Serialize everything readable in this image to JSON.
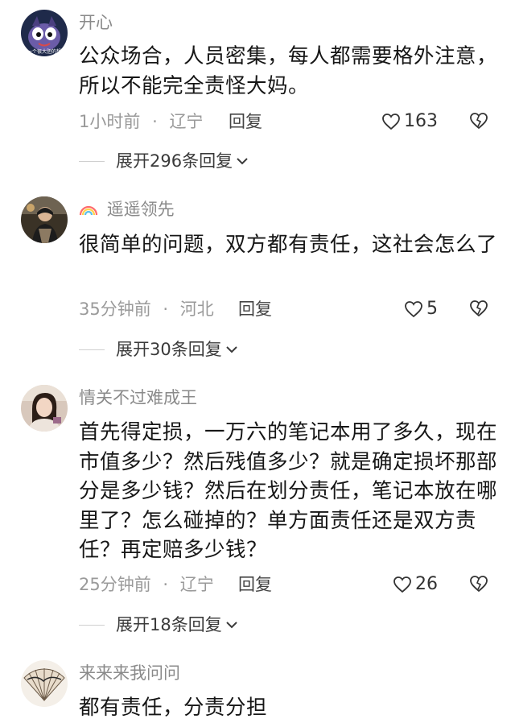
{
  "comments": [
    {
      "username": "开心",
      "avatar_icon": "cartoon-avatar-icon",
      "avatar_caption": "我一个很大胆的想",
      "content": "公众场合，人员密集，每人都需要格外注意，所以不能完全责怪大妈。",
      "time": "1小时前",
      "location": "辽宁",
      "reply_label": "回复",
      "likes": "163",
      "expand_label": "展开296条回复"
    },
    {
      "username": "遥遥领先",
      "username_prefix_icon": "rainbow-icon",
      "avatar_icon": "person-photo-avatar-icon",
      "content": "很简单的问题，双方都有责任，这社会怎么了",
      "time": "35分钟前",
      "location": "河北",
      "reply_label": "回复",
      "likes": "5",
      "expand_label": "展开30条回复"
    },
    {
      "username": "情关不过难成王",
      "avatar_icon": "girl-photo-avatar-icon",
      "content": "首先得定损，一万六的笔记本用了多久，现在市值多少？然后残值多少？就是确定损坏那部分是多少钱？然后在划分责任，笔记本放在哪里了？怎么碰掉的？单方面责任还是双方责任？再定赔多少钱？",
      "time": "25分钟前",
      "location": "辽宁",
      "reply_label": "回复",
      "likes": "26",
      "expand_label": "展开18条回复"
    },
    {
      "username": "来来来我问问",
      "avatar_icon": "fan-avatar-icon",
      "content": "都有责任，分责分担"
    }
  ],
  "meta_separator": "·",
  "colors": {
    "username": "#8a8a8a",
    "meta": "#9a9a9a",
    "content": "#161616"
  }
}
